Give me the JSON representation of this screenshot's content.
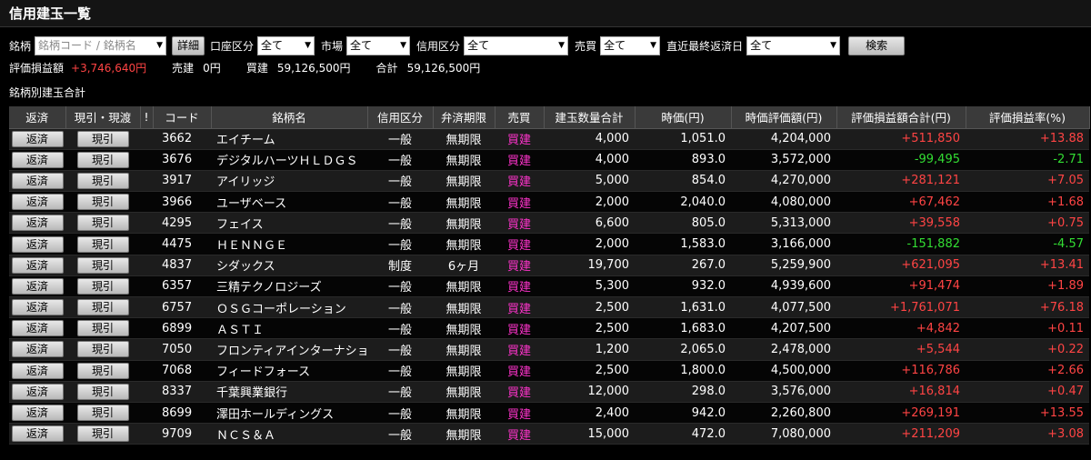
{
  "header": {
    "title": "信用建玉一覧"
  },
  "filters": {
    "meigara_label": "銘柄",
    "meigara_placeholder": "銘柄コード / 銘柄名",
    "detail_button": "詳細",
    "account_label": "口座区分",
    "account_value": "全て",
    "market_label": "市場",
    "market_value": "全て",
    "credit_label": "信用区分",
    "credit_value": "全て",
    "trade_label": "売買",
    "trade_value": "全て",
    "due_label": "直近最終返済日",
    "due_value": "全て",
    "search_button": "検索"
  },
  "summary": {
    "pl_label": "評価損益額",
    "pl_value": "+3,746,640円",
    "sell_label": "売建",
    "sell_value": "0円",
    "buy_label": "買建",
    "buy_value": "59,126,500円",
    "total_label": "合計",
    "total_value": "59,126,500円"
  },
  "section_title": "銘柄別建玉合計",
  "table": {
    "headers": [
      "返済",
      "現引・現渡",
      "!",
      "コード",
      "銘柄名",
      "信用区分",
      "弁済期限",
      "売買",
      "建玉数量合計",
      "時価(円)",
      "時価評価額(円)",
      "評価損益額合計(円)",
      "評価損益率(%)"
    ],
    "repay_button": "返済",
    "genbiki_button": "現引",
    "rows": [
      {
        "code": "3662",
        "name": "エイチーム",
        "credit": "一般",
        "due": "無期限",
        "side": "買建",
        "qty": "4,000",
        "price": "1,051.0",
        "value": "4,204,000",
        "pl": "+511,850",
        "rate": "+13.88",
        "sign": "pos"
      },
      {
        "code": "3676",
        "name": "デジタルハーツＨＬＤＧＳ",
        "credit": "一般",
        "due": "無期限",
        "side": "買建",
        "qty": "4,000",
        "price": "893.0",
        "value": "3,572,000",
        "pl": "-99,495",
        "rate": "-2.71",
        "sign": "neg"
      },
      {
        "code": "3917",
        "name": "アイリッジ",
        "credit": "一般",
        "due": "無期限",
        "side": "買建",
        "qty": "5,000",
        "price": "854.0",
        "value": "4,270,000",
        "pl": "+281,121",
        "rate": "+7.05",
        "sign": "pos"
      },
      {
        "code": "3966",
        "name": "ユーザベース",
        "credit": "一般",
        "due": "無期限",
        "side": "買建",
        "qty": "2,000",
        "price": "2,040.0",
        "value": "4,080,000",
        "pl": "+67,462",
        "rate": "+1.68",
        "sign": "pos"
      },
      {
        "code": "4295",
        "name": "フェイス",
        "credit": "一般",
        "due": "無期限",
        "side": "買建",
        "qty": "6,600",
        "price": "805.0",
        "value": "5,313,000",
        "pl": "+39,558",
        "rate": "+0.75",
        "sign": "pos"
      },
      {
        "code": "4475",
        "name": "ＨＥＮＮＧＥ",
        "credit": "一般",
        "due": "無期限",
        "side": "買建",
        "qty": "2,000",
        "price": "1,583.0",
        "value": "3,166,000",
        "pl": "-151,882",
        "rate": "-4.57",
        "sign": "neg"
      },
      {
        "code": "4837",
        "name": "シダックス",
        "credit": "制度",
        "due": "6ヶ月",
        "side": "買建",
        "qty": "19,700",
        "price": "267.0",
        "value": "5,259,900",
        "pl": "+621,095",
        "rate": "+13.41",
        "sign": "pos"
      },
      {
        "code": "6357",
        "name": "三精テクノロジーズ",
        "credit": "一般",
        "due": "無期限",
        "side": "買建",
        "qty": "5,300",
        "price": "932.0",
        "value": "4,939,600",
        "pl": "+91,474",
        "rate": "+1.89",
        "sign": "pos"
      },
      {
        "code": "6757",
        "name": "ＯＳＧコーポレーション",
        "credit": "一般",
        "due": "無期限",
        "side": "買建",
        "qty": "2,500",
        "price": "1,631.0",
        "value": "4,077,500",
        "pl": "+1,761,071",
        "rate": "+76.18",
        "sign": "pos"
      },
      {
        "code": "6899",
        "name": "ＡＳＴＩ",
        "credit": "一般",
        "due": "無期限",
        "side": "買建",
        "qty": "2,500",
        "price": "1,683.0",
        "value": "4,207,500",
        "pl": "+4,842",
        "rate": "+0.11",
        "sign": "pos"
      },
      {
        "code": "7050",
        "name": "フロンティアインターナショナル",
        "credit": "一般",
        "due": "無期限",
        "side": "買建",
        "qty": "1,200",
        "price": "2,065.0",
        "value": "2,478,000",
        "pl": "+5,544",
        "rate": "+0.22",
        "sign": "pos"
      },
      {
        "code": "7068",
        "name": "フィードフォース",
        "credit": "一般",
        "due": "無期限",
        "side": "買建",
        "qty": "2,500",
        "price": "1,800.0",
        "value": "4,500,000",
        "pl": "+116,786",
        "rate": "+2.66",
        "sign": "pos"
      },
      {
        "code": "8337",
        "name": "千葉興業銀行",
        "credit": "一般",
        "due": "無期限",
        "side": "買建",
        "qty": "12,000",
        "price": "298.0",
        "value": "3,576,000",
        "pl": "+16,814",
        "rate": "+0.47",
        "sign": "pos"
      },
      {
        "code": "8699",
        "name": "澤田ホールディングス",
        "credit": "一般",
        "due": "無期限",
        "side": "買建",
        "qty": "2,400",
        "price": "942.0",
        "value": "2,260,800",
        "pl": "+269,191",
        "rate": "+13.55",
        "sign": "pos"
      },
      {
        "code": "9709",
        "name": "ＮＣＳ＆Ａ",
        "credit": "一般",
        "due": "無期限",
        "side": "買建",
        "qty": "15,000",
        "price": "472.0",
        "value": "7,080,000",
        "pl": "+211,209",
        "rate": "+3.08",
        "sign": "pos"
      }
    ]
  },
  "colors": {
    "positive": "#ff4444",
    "negative": "#33dd33",
    "buy": "#ff33cc"
  }
}
